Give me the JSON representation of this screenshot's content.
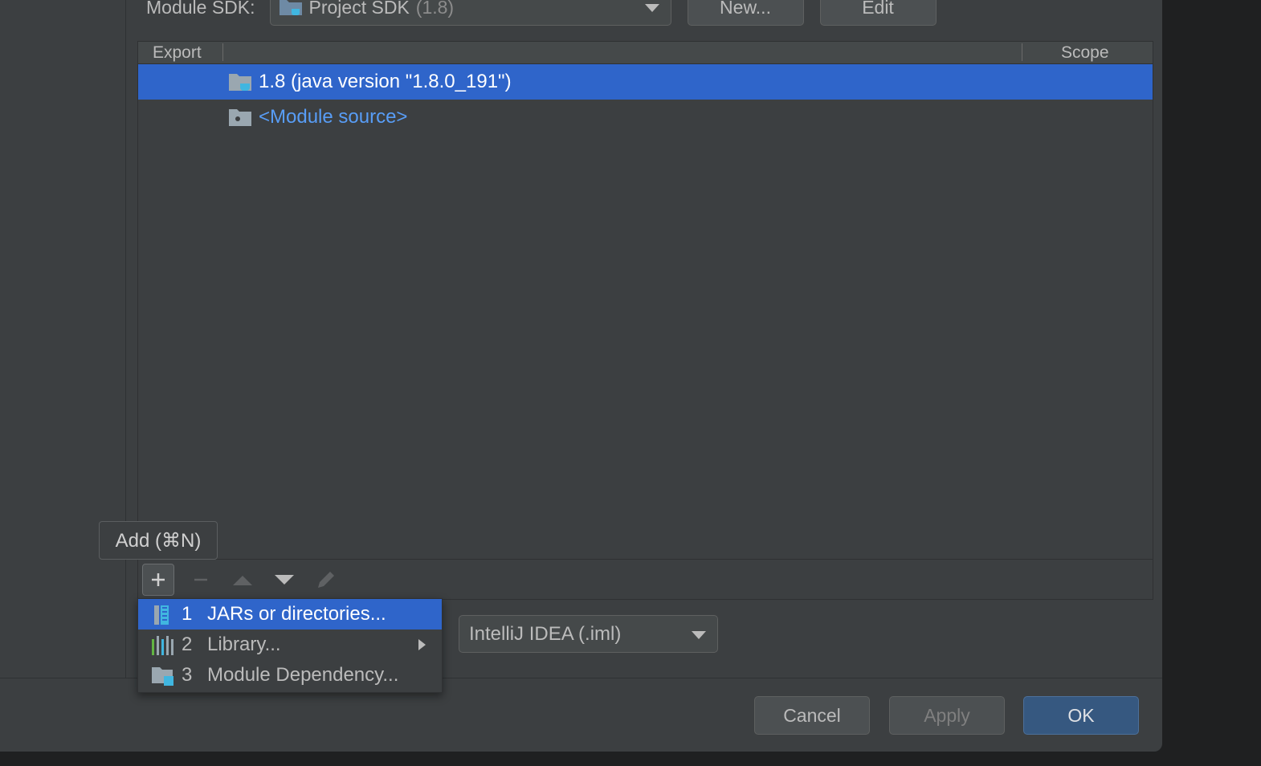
{
  "sdk": {
    "label": "Module SDK:",
    "value": "Project SDK",
    "version": "(1.8)",
    "new_label": "New...",
    "edit_label": "Edit"
  },
  "table": {
    "headers": {
      "export": "Export",
      "scope": "Scope"
    },
    "rows": [
      {
        "label": "1.8 (java version \"1.8.0_191\")",
        "icon": "jdk-folder-icon",
        "selected": true
      },
      {
        "label": "<Module source>",
        "icon": "module-source-folder-icon",
        "selected": false
      }
    ]
  },
  "toolbar": {
    "tooltip": "Add (⌘N)",
    "items": [
      "add-icon",
      "remove-icon",
      "move-up-icon",
      "move-down-icon",
      "edit-icon"
    ]
  },
  "add_menu": {
    "items": [
      {
        "num": "1",
        "label": "JARs or directories...",
        "icon": "jar-icon",
        "active": true,
        "submenu": false
      },
      {
        "num": "2",
        "label": "Library...",
        "icon": "library-icon",
        "active": false,
        "submenu": true
      },
      {
        "num": "3",
        "label": "Module Dependency...",
        "icon": "module-dependency-icon",
        "active": false,
        "submenu": false
      }
    ]
  },
  "format": {
    "value": "IntelliJ IDEA (.iml)"
  },
  "footer": {
    "cancel_label": "Cancel",
    "apply_label": "Apply",
    "ok_label": "OK"
  },
  "colors": {
    "selection": "#2f65ca",
    "background": "#3c3f41",
    "link": "#589df6",
    "ok_button": "#365880"
  }
}
